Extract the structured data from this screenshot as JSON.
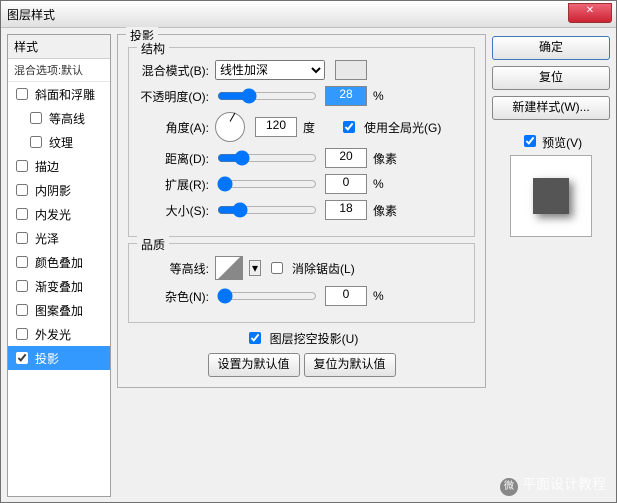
{
  "title": "图层样式",
  "left": {
    "header": "样式",
    "subheader": "混合选项:默认",
    "items": [
      {
        "label": "斜面和浮雕",
        "checked": false,
        "indent": false
      },
      {
        "label": "等高线",
        "checked": false,
        "indent": true
      },
      {
        "label": "纹理",
        "checked": false,
        "indent": true
      },
      {
        "label": "描边",
        "checked": false,
        "indent": false
      },
      {
        "label": "内阴影",
        "checked": false,
        "indent": false
      },
      {
        "label": "内发光",
        "checked": false,
        "indent": false
      },
      {
        "label": "光泽",
        "checked": false,
        "indent": false
      },
      {
        "label": "颜色叠加",
        "checked": false,
        "indent": false
      },
      {
        "label": "渐变叠加",
        "checked": false,
        "indent": false
      },
      {
        "label": "图案叠加",
        "checked": false,
        "indent": false
      },
      {
        "label": "外发光",
        "checked": false,
        "indent": false
      },
      {
        "label": "投影",
        "checked": true,
        "indent": false,
        "selected": true
      }
    ]
  },
  "center": {
    "section_title": "投影",
    "structure": {
      "title": "结构",
      "blend_mode_label": "混合模式(B):",
      "blend_mode_value": "线性加深",
      "opacity_label": "不透明度(O):",
      "opacity_value": "28",
      "opacity_unit": "%",
      "angle_label": "角度(A):",
      "angle_value": "120",
      "angle_unit": "度",
      "global_light_label": "使用全局光(G)",
      "global_light_checked": true,
      "distance_label": "距离(D):",
      "distance_value": "20",
      "distance_unit": "像素",
      "spread_label": "扩展(R):",
      "spread_value": "0",
      "spread_unit": "%",
      "size_label": "大小(S):",
      "size_value": "18",
      "size_unit": "像素"
    },
    "quality": {
      "title": "品质",
      "contour_label": "等高线:",
      "antialias_label": "消除锯齿(L)",
      "antialias_checked": false,
      "noise_label": "杂色(N):",
      "noise_value": "0",
      "noise_unit": "%"
    },
    "knockout_label": "图层挖空投影(U)",
    "knockout_checked": true,
    "btn_default": "设置为默认值",
    "btn_reset": "复位为默认值"
  },
  "right": {
    "ok": "确定",
    "cancel": "复位",
    "newstyle": "新建样式(W)...",
    "preview_label": "预览(V)",
    "preview_checked": true
  },
  "watermark": "平面设计教程"
}
